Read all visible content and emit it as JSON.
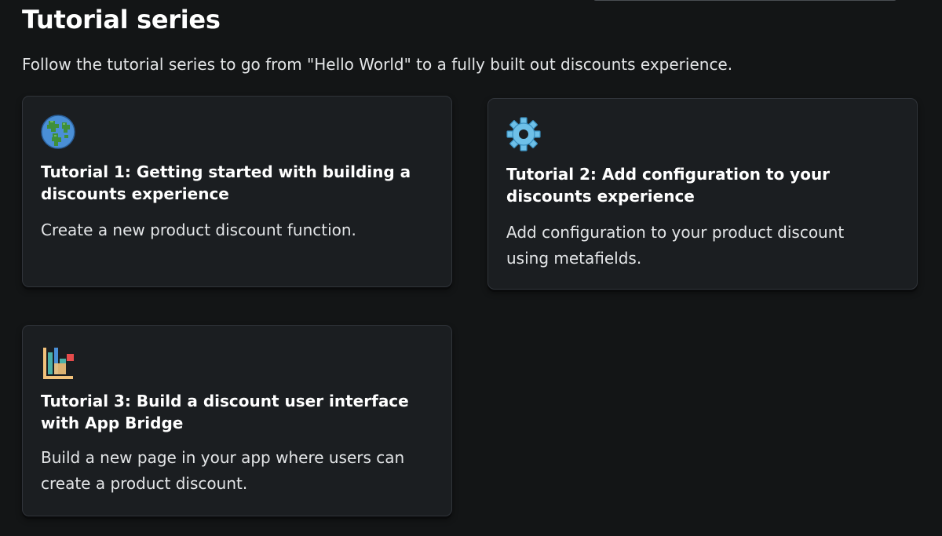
{
  "page": {
    "title": "Tutorial series",
    "intro": "Follow the tutorial series to go from \"Hello World\" to a fully built out discounts experience."
  },
  "cards": [
    {
      "icon": "globe-icon",
      "title": "Tutorial 1: Getting started with building a discounts experience",
      "description": "Create a new product discount function."
    },
    {
      "icon": "gear-icon",
      "title": "Tutorial 2: Add configuration to your discounts experience",
      "description": "Add configuration to your product discount using metafields."
    },
    {
      "icon": "bar-chart-icon",
      "title": "Tutorial 3: Build a discount user interface with App Bridge",
      "description": "Build a new page in your app where users can create a product discount."
    }
  ],
  "colors": {
    "background": "#131516",
    "card_background": "#1b1e21",
    "card_border": "#30343a",
    "title_text": "#ffffff",
    "body_text": "#e3e5e7"
  }
}
